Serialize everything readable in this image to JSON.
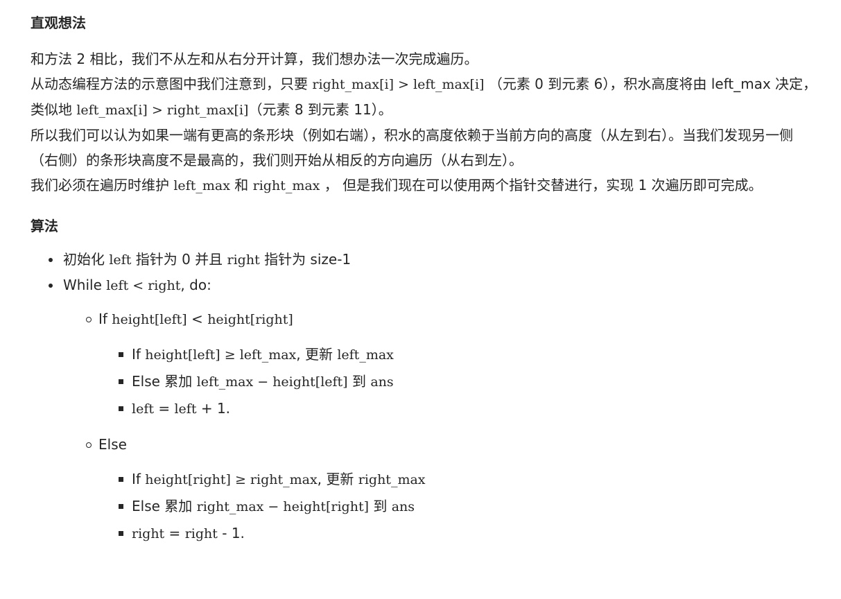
{
  "intuition": {
    "heading": "直观想法",
    "p1": "和方法 2 相比，我们不从左和从右分开计算，我们想办法一次完成遍历。",
    "p2": {
      "t1": "从动态编程方法的示意图中我们注意到，只要 ",
      "m1": "right_max[i] > left_max[i]",
      "t2": " （元素 0 到元素 6），积水高度将由 left_max 决定，类似地 ",
      "m2": "left_max[i] > right_max[i]",
      "t3": "（元素 8 到元素 11）。"
    },
    "p3": "所以我们可以认为如果一端有更高的条形块（例如右端），积水的高度依赖于当前方向的高度（从左到右）。当我们发现另一侧（右侧）的条形块高度不是最高的，我们则开始从相反的方向遍历（从右到左）。",
    "p4": {
      "t1": "我们必须在遍历时维护 ",
      "m1": "left_max",
      "t2": " 和 ",
      "m2": "right_max",
      "t3": " ， 但是我们现在可以使用两个指针交替进行，实现 1 次遍历即可完成。"
    }
  },
  "algorithm": {
    "heading": "算法",
    "step1": {
      "t1": "初始化 ",
      "m1": "left",
      "t2": " 指针为 0 并且 ",
      "m2": "right",
      "t3": " 指针为 size-1"
    },
    "step2": {
      "t1": "While ",
      "m1": "left < right",
      "t2": ", do:"
    },
    "if_branch": {
      "t1": "If ",
      "m1": "height[left]",
      "t2": " < ",
      "m2": "height[right]",
      "items": [
        {
          "t1": "If ",
          "m1": "height[left] ≥ left_max",
          "t2": ", 更新 ",
          "m2": "left_max",
          "t3": ""
        },
        {
          "t1": "Else 累加 ",
          "m1": "left_max − height[left]",
          "t2": " 到 ",
          "m2": "ans",
          "t3": ""
        },
        {
          "t1": "",
          "m1": "left",
          "t2": " = ",
          "m2": "left",
          "t3": " + 1."
        }
      ]
    },
    "else_branch": {
      "label": "Else",
      "items": [
        {
          "t1": "If ",
          "m1": "height[right] ≥ right_max",
          "t2": ", 更新 ",
          "m2": "right_max",
          "t3": ""
        },
        {
          "t1": "Else 累加 ",
          "m1": "right_max − height[right]",
          "t2": " 到 ",
          "m2": "ans",
          "t3": ""
        },
        {
          "t1": "",
          "m1": "right",
          "t2": " = ",
          "m2": "right",
          "t3": " - 1."
        }
      ]
    }
  }
}
